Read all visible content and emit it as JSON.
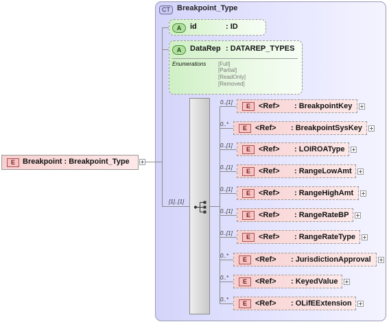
{
  "root_element": {
    "badge": "E",
    "label": "Breakpoint : Breakpoint_Type"
  },
  "complex_type": {
    "badge": "CT",
    "name": "Breakpoint_Type"
  },
  "attributes": [
    {
      "badge": "A",
      "name": "id",
      "type": ": ID"
    },
    {
      "badge": "A",
      "name": "DataRep",
      "type": ": DATAREP_TYPES"
    }
  ],
  "enumerations": {
    "label": "Enumerations",
    "values": [
      "[Full]",
      "[Partial]",
      "[ReadOnly]",
      "[Removed]"
    ]
  },
  "sequence": {
    "multiplicity": "[1]..[1]"
  },
  "children": [
    {
      "mult": "0..[1]",
      "badge": "E",
      "ref": "<Ref>",
      "name": ": BreakpointKey"
    },
    {
      "mult": "0..*",
      "badge": "E",
      "ref": "<Ref>",
      "name": ": BreakpointSysKey"
    },
    {
      "mult": "0..[1]",
      "badge": "E",
      "ref": "<Ref>",
      "name": ": LOIROAType"
    },
    {
      "mult": "0..[1]",
      "badge": "E",
      "ref": "<Ref>",
      "name": ": RangeLowAmt"
    },
    {
      "mult": "0..[1]",
      "badge": "E",
      "ref": "<Ref>",
      "name": ": RangeHighAmt"
    },
    {
      "mult": "0..[1]",
      "badge": "E",
      "ref": "<Ref>",
      "name": ": RangeRateBP"
    },
    {
      "mult": "0..[1]",
      "badge": "E",
      "ref": "<Ref>",
      "name": ": RangeRateType"
    },
    {
      "mult": "0..*",
      "badge": "E",
      "ref": "<Ref>",
      "name": ": JurisdictionApproval"
    },
    {
      "mult": "0..*",
      "badge": "E",
      "ref": "<Ref>",
      "name": ": KeyedValue"
    },
    {
      "mult": "0..*",
      "badge": "E",
      "ref": "<Ref>",
      "name": ": OLifEExtension"
    }
  ]
}
